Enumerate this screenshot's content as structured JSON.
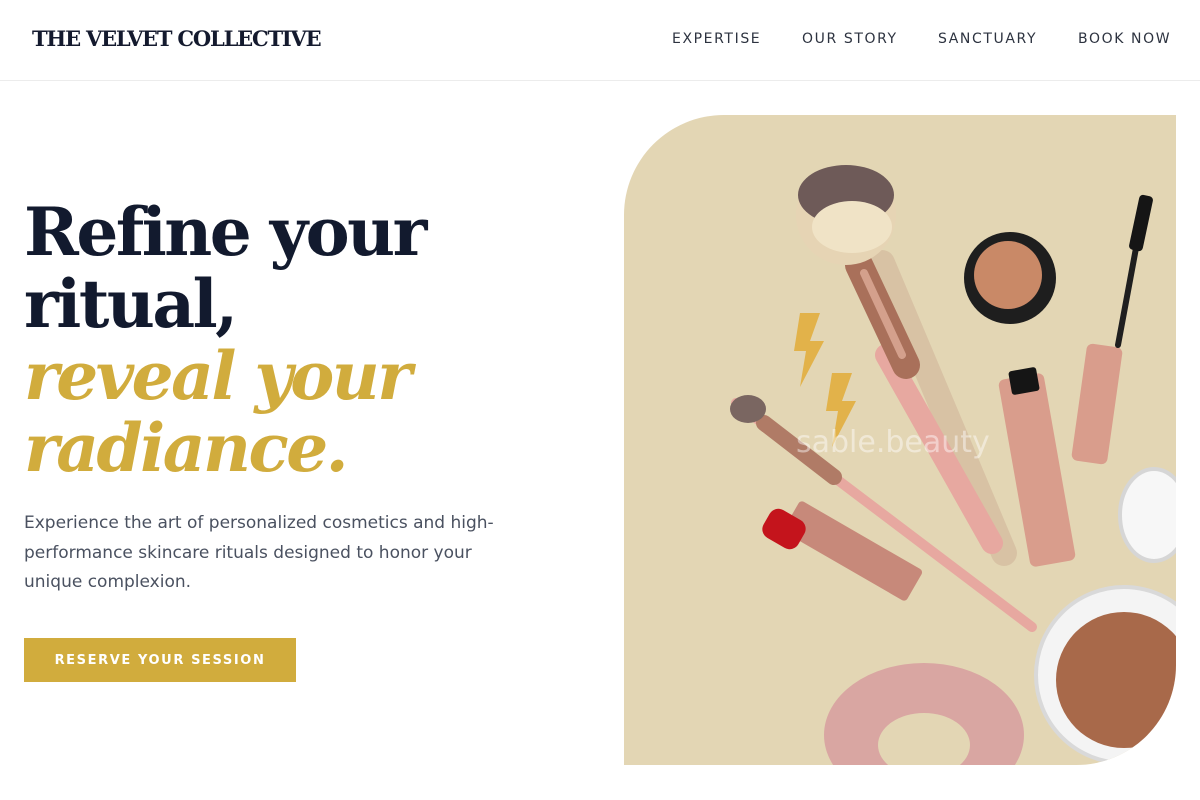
{
  "brand": {
    "name": "THE VELVET COLLECTIVE"
  },
  "nav": {
    "items": [
      {
        "label": "EXPERTISE"
      },
      {
        "label": "OUR STORY"
      },
      {
        "label": "SANCTUARY"
      },
      {
        "label": "BOOK NOW"
      }
    ]
  },
  "hero": {
    "title_line1": "Refine your",
    "title_line2": "ritual,",
    "title_line3": "reveal your",
    "title_line4": "radiance.",
    "subtitle": "Experience the art of personalized cosmetics and high-performance skincare rituals designed to honor your unique complexion.",
    "cta_label": "RESERVE YOUR SESSION",
    "image_watermark": "sable.beauty"
  },
  "colors": {
    "accent": "#d1ac3d",
    "heading": "#121a2e",
    "image_bg": "#e3d6b4"
  }
}
